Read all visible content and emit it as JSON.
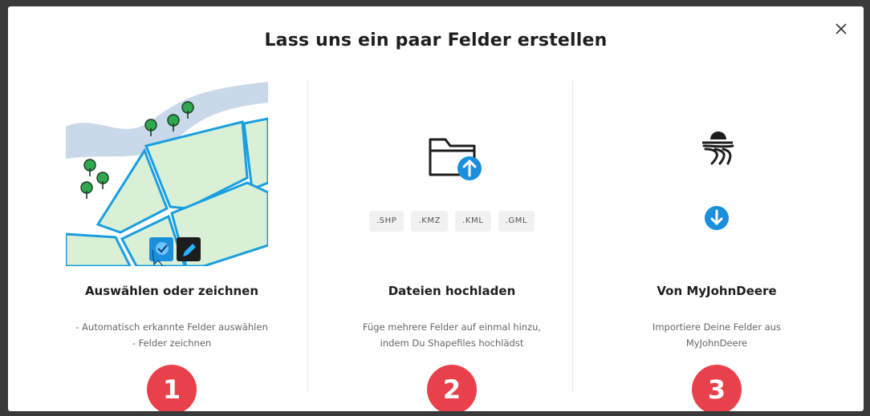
{
  "modal": {
    "title": "Lass uns ein paar Felder erstellen",
    "close_label": "×"
  },
  "options": [
    {
      "title": "Auswählen oder zeichnen",
      "desc_line1": "- Automatisch erkannte Felder auswählen",
      "desc_line2": "- Felder zeichnen",
      "badge": "1",
      "icon": "field-map-illustration"
    },
    {
      "title": "Dateien hochladen",
      "desc_line1": "Füge mehrere Felder auf einmal hinzu,",
      "desc_line2": "indem Du Shapefiles hochlädst",
      "badge": "2",
      "icon": "folder-upload-icon",
      "formats": [
        ".SHP",
        ".KMZ",
        ".KML",
        ".GML"
      ]
    },
    {
      "title": "Von MyJohnDeere",
      "desc_line1": "Importiere Deine Felder aus",
      "desc_line2": "MyJohnDeere",
      "badge": "3",
      "icon": "field-sun-icon"
    }
  ],
  "colors": {
    "accent_blue": "#1a8fdc",
    "badge_red": "#e8414b",
    "field_green": "#d9f0d6",
    "river": "#c9d9ea"
  }
}
